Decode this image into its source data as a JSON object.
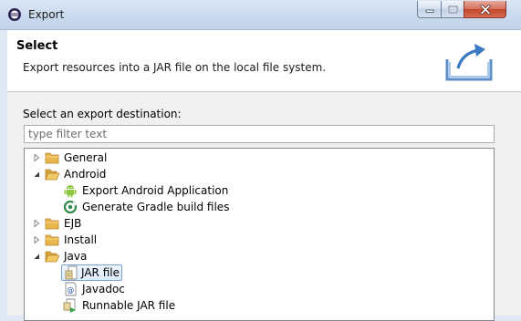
{
  "window": {
    "title": "Export"
  },
  "banner": {
    "title": "Select",
    "description": "Export resources into a JAR file on the local file system."
  },
  "destination": {
    "label": "Select an export destination:",
    "filter_placeholder": "type filter text"
  },
  "tree": {
    "general": "General",
    "android": "Android",
    "export_android_app": "Export Android Application",
    "generate_gradle": "Generate Gradle build files",
    "ejb": "EJB",
    "install": "Install",
    "java": "Java",
    "jar_file": "JAR file",
    "javadoc": "Javadoc",
    "runnable_jar": "Runnable JAR file"
  },
  "colors": {
    "folder": "#e8b64a",
    "android_green": "#8cc63f",
    "selection_border": "#7da2ce"
  }
}
